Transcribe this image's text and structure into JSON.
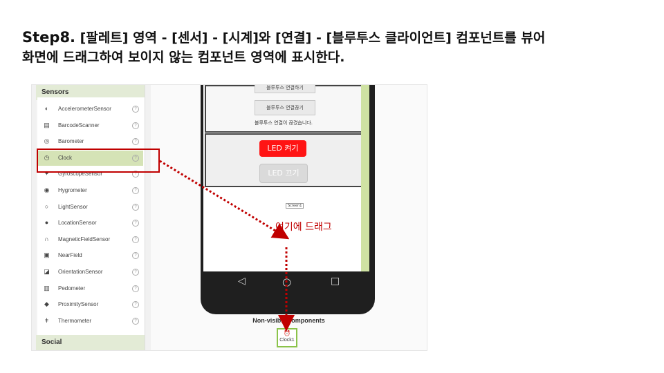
{
  "slide": {
    "title_step": "Step8.",
    "title_rest": "[팔레트] 영역 - [센서] - [시계]와 [연결] - [블루투스 클라이언트] 컴포넌트를 뷰어",
    "title_line2": "화면에 드래그하여 보이지 않는 컴포넌트 영역에 표시한다."
  },
  "palette": {
    "header": "Sensors",
    "footer": "Social",
    "items": [
      {
        "label": "AccelerometerSensor",
        "icon": "accelerometer-icon"
      },
      {
        "label": "BarcodeScanner",
        "icon": "barcode-icon"
      },
      {
        "label": "Barometer",
        "icon": "barometer-icon"
      },
      {
        "label": "Clock",
        "icon": "clock-icon"
      },
      {
        "label": "GyroscopeSensor",
        "icon": "gyroscope-icon"
      },
      {
        "label": "Hygrometer",
        "icon": "hygrometer-icon"
      },
      {
        "label": "LightSensor",
        "icon": "light-icon"
      },
      {
        "label": "LocationSensor",
        "icon": "location-icon"
      },
      {
        "label": "MagneticFieldSensor",
        "icon": "magnet-icon"
      },
      {
        "label": "NearField",
        "icon": "nfc-icon"
      },
      {
        "label": "OrientationSensor",
        "icon": "orientation-icon"
      },
      {
        "label": "Pedometer",
        "icon": "pedometer-icon"
      },
      {
        "label": "ProximitySensor",
        "icon": "proximity-icon"
      },
      {
        "label": "Thermometer",
        "icon": "thermometer-icon"
      }
    ],
    "help_glyph": "?"
  },
  "phone": {
    "btn_top_partial": "블루투스 연결하기",
    "btn_disconnect": "블루투스 연결끊기",
    "status": "블루투스 연결이 끊겼습니다.",
    "led_on": "LED 켜기",
    "led_off": "LED 끄기",
    "screen_label": "Screen1"
  },
  "nonvisible": {
    "label": "Non-visible components",
    "component": "Clock1"
  },
  "annotation": "여기에 드래그",
  "colors": {
    "highlight": "#c00000",
    "selected": "#d5e3b6",
    "accent": "#8bc34a",
    "led_on": "#ff1414"
  }
}
